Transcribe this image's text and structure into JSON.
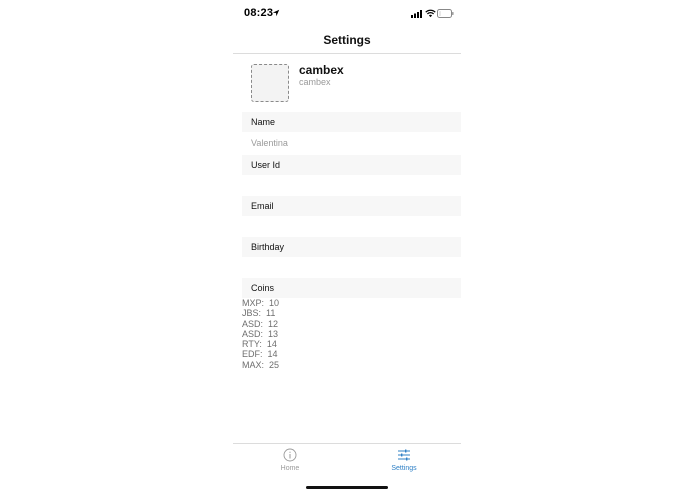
{
  "status_bar": {
    "time": "08:23"
  },
  "nav": {
    "title": "Settings"
  },
  "profile": {
    "name": "cambex",
    "username": "cambex"
  },
  "fields": {
    "name_label": "Name",
    "name_value": "Valentina",
    "user_id_label": "User Id",
    "user_id_value": "",
    "email_label": "Email",
    "email_value": "",
    "birthday_label": "Birthday",
    "birthday_value": "",
    "coins_label": "Coins"
  },
  "coins": [
    {
      "code": "MXP:",
      "amount": "10"
    },
    {
      "code": "JBS:",
      "amount": "11"
    },
    {
      "code": "ASD:",
      "amount": "12"
    },
    {
      "code": "ASD:",
      "amount": "13"
    },
    {
      "code": "RTY:",
      "amount": "14"
    },
    {
      "code": "EDF:",
      "amount": "14"
    },
    {
      "code": "MAX:",
      "amount": "25"
    }
  ],
  "tabs": [
    {
      "label": "Home",
      "icon": "info-icon",
      "active": false
    },
    {
      "label": "Settings",
      "icon": "sliders-icon",
      "active": true
    }
  ],
  "colors": {
    "accent": "#2f80c6",
    "inactive": "#9a9a9a",
    "section_bg": "#f7f7f7"
  }
}
